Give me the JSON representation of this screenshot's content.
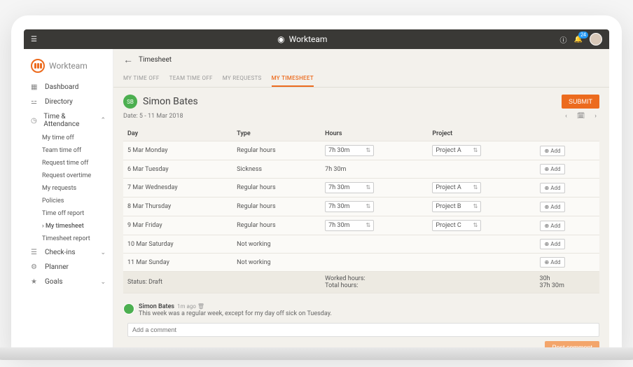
{
  "app": {
    "name": "Workteam",
    "notification_count": "24"
  },
  "sidebar": {
    "logo": "Workteam",
    "items": [
      {
        "label": "Dashboard",
        "icon": "▦"
      },
      {
        "label": "Directory",
        "icon": "⚍"
      },
      {
        "label": "Time & Attendance",
        "icon": "◷",
        "expanded": true
      },
      {
        "label": "Check-ins",
        "icon": "☰"
      },
      {
        "label": "Planner",
        "icon": "⚙"
      },
      {
        "label": "Goals",
        "icon": "★"
      }
    ],
    "time_sub": [
      "My time off",
      "Team time off",
      "Request time off",
      "Request overtime",
      "My requests",
      "Policies",
      "Time off report",
      "My timesheet",
      "Timesheet report"
    ]
  },
  "page": {
    "title": "Timesheet",
    "tabs": [
      "MY TIME OFF",
      "TEAM TIME OFF",
      "MY REQUESTS",
      "MY TIMESHEET"
    ],
    "user_initials": "SB",
    "user_name": "Simon Bates",
    "submit_label": "SUBMIT",
    "date_label": "Date: 5 - 11 Mar 2018",
    "columns": [
      "Day",
      "Type",
      "Hours",
      "Project",
      ""
    ],
    "rows": [
      {
        "day": "5 Mar Monday",
        "type": "Regular hours",
        "hours": "7h 30m",
        "project": "Project A",
        "hours_sel": true,
        "proj_sel": true
      },
      {
        "day": "6 Mar Tuesday",
        "type": "Sickness",
        "hours": "7h 30m",
        "project": "",
        "hours_sel": false,
        "proj_sel": false
      },
      {
        "day": "7 Mar Wednesday",
        "type": "Regular hours",
        "hours": "7h 30m",
        "project": "Project A",
        "hours_sel": true,
        "proj_sel": true
      },
      {
        "day": "8 Mar Thursday",
        "type": "Regular hours",
        "hours": "7h 30m",
        "project": "Project B",
        "hours_sel": true,
        "proj_sel": true
      },
      {
        "day": "9 Mar Friday",
        "type": "Regular hours",
        "hours": "7h 30m",
        "project": "Project C",
        "hours_sel": true,
        "proj_sel": true
      },
      {
        "day": "10 Mar Saturday",
        "type": "Not working",
        "hours": "",
        "project": "",
        "hours_sel": false,
        "proj_sel": false
      },
      {
        "day": "11 Mar Sunday",
        "type": "Not working",
        "hours": "",
        "project": "",
        "hours_sel": false,
        "proj_sel": false
      }
    ],
    "add_label": "Add",
    "status_label": "Status:",
    "status_value": "Draft",
    "worked_label": "Worked hours:",
    "worked_value": "30h",
    "total_label": "Total hours:",
    "total_value": "37h 30m"
  },
  "comments": {
    "items": [
      {
        "author": "Simon Bates",
        "meta": "1m ago",
        "text": "This week was a regular week, except for my day off sick on Tuesday."
      }
    ],
    "placeholder": "Add a comment",
    "post_label": "Post comment"
  }
}
